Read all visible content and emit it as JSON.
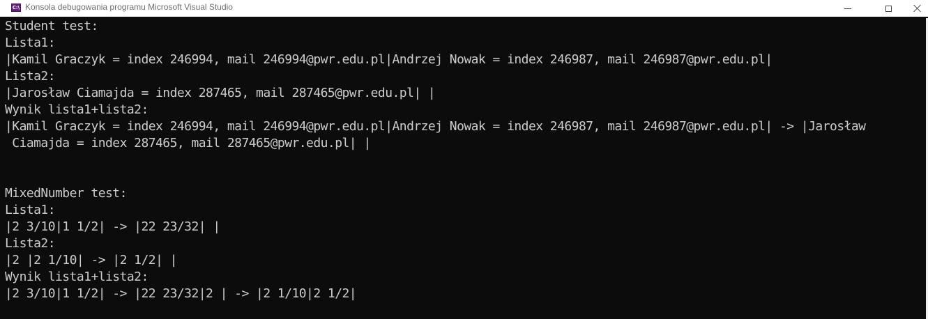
{
  "window": {
    "title": "Konsola debugowania programu Microsoft Visual Studio",
    "app_icon": "visual-studio-console-icon",
    "controls": {
      "minimize": "minimize-icon",
      "maximize": "maximize-icon",
      "close": "close-icon"
    }
  },
  "console": {
    "lines": [
      "Student test:",
      "Lista1:",
      "|Kamil Graczyk = index 246994, mail 246994@pwr.edu.pl|Andrzej Nowak = index 246987, mail 246987@pwr.edu.pl|",
      "Lista2:",
      "|Jarosław Ciamajda = index 287465, mail 287465@pwr.edu.pl| |",
      "Wynik lista1+lista2:",
      "|Kamil Graczyk = index 246994, mail 246994@pwr.edu.pl|Andrzej Nowak = index 246987, mail 246987@pwr.edu.pl| -> |Jarosław",
      " Ciamajda = index 287465, mail 287465@pwr.edu.pl| |",
      "",
      "",
      "MixedNumber test:",
      "Lista1:",
      "|2 3/10|1 1/2| -> |22 23/32| |",
      "Lista2:",
      "|2 |2 1/10| -> |2 1/2| |",
      "Wynik lista1+lista2:",
      "|2 3/10|1 1/2| -> |22 23/32|2 | -> |2 1/10|2 1/2|"
    ]
  },
  "colors": {
    "console_background": "#0c0c0c",
    "console_text": "#cccccc",
    "titlebar_background": "#ffffff",
    "title_text": "#6e6e6e"
  }
}
